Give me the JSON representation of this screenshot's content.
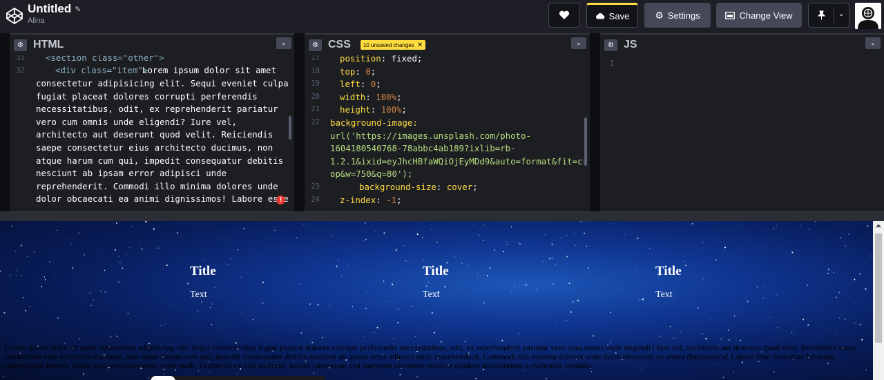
{
  "header": {
    "title": "Untitled",
    "author": "Alina",
    "save_label": "Save",
    "settings_label": "Settings",
    "change_view_label": "Change View"
  },
  "panes": {
    "html": {
      "name": "HTML"
    },
    "css": {
      "name": "CSS",
      "badge": "10 unsaved changes"
    },
    "js": {
      "name": "JS"
    }
  },
  "html_code": {
    "line_numbers": [
      "31",
      "32"
    ],
    "section_line": "<section class=\"other\">",
    "div_open": "<div class=\"item\">",
    "lines": [
      "Lorem ipsum dolor sit amet",
      "consectetur adipisicing elit. Sequi eveniet culpa",
      "fugiat placeat dolores corrupti perferendis",
      "necessitatibus, odit, ex reprehenderit pariatur",
      "vero cum omnis unde eligendi? Iure vel,",
      "architecto aut deserunt quod velit. Reiciendis",
      "saepe consectetur eius architecto ducimus, non",
      "atque harum cum qui, impedit consequatur debitis",
      "nesciunt ab ipsam error adipisci unde",
      "reprehenderit. Commodi illo minima dolores unde",
      "dolor obcaecati ea animi dignissimos! Labore esse"
    ]
  },
  "css_code": {
    "lines": [
      {
        "n": "17",
        "prop": "position",
        "val": "fixed",
        "type": "plain"
      },
      {
        "n": "18",
        "prop": "top",
        "val": "0",
        "type": "num"
      },
      {
        "n": "19",
        "prop": "left",
        "val": "0",
        "type": "num"
      },
      {
        "n": "20",
        "prop": "width",
        "val": "100%",
        "type": "num"
      },
      {
        "n": "21",
        "prop": "height",
        "val": "100%",
        "type": "num"
      }
    ],
    "bg_line_number": "22",
    "bg_prop": "background-image:",
    "url_lines": [
      "url('https://images.unsplash.com/photo-",
      "1604180540768-78abbc4ab189?ixlib=rb-",
      "1.2.1&ixid=eyJhcHBfaWQiOjEyMDd9&auto=format&fit=cr",
      "op&w=750&q=80');"
    ],
    "line23": {
      "n": "23",
      "prop": "background-size",
      "val": "cover"
    },
    "line24": {
      "n": "24",
      "prop": "z-index",
      "val": "-1"
    }
  },
  "js_code": {
    "line_number": "1"
  },
  "preview": {
    "items": [
      {
        "title": "Title",
        "text": "Text"
      },
      {
        "title": "Title",
        "text": "Text"
      },
      {
        "title": "Title",
        "text": "Text"
      }
    ],
    "lorem": "Lorem ipsum dolor sit amet consectetur adipisicing elit. Sequi eveniet culpa fugiat placeat dolores corrupti perferendis necessitatibus, odit, ex reprehenderit pariatur vero cum omnis unde eligendi? Iure vel, architecto aut deserunt quod velit. Reiciendis saepe consectetur eius architecto ducimus, non atque harum cum qui, impedit consequatur debitis nesciunt ab ipsam error adipisci unde reprehenderit. Commodi illo minima dolores unde dolor obcaecati ea animi dignissimos! Labore esse molestiae laborum consequatur tenetur totam nam vero provident enim modi. Distinctio ex nisi nostrum, harum laborosam sint magnam inventore mollitia quidem accusantium a molestias veritatis."
  },
  "colors": {
    "accent": "#ffdd40",
    "header_bg": "#1e1f26",
    "editor_bg": "#1d1e22",
    "button_bg": "#444857"
  }
}
